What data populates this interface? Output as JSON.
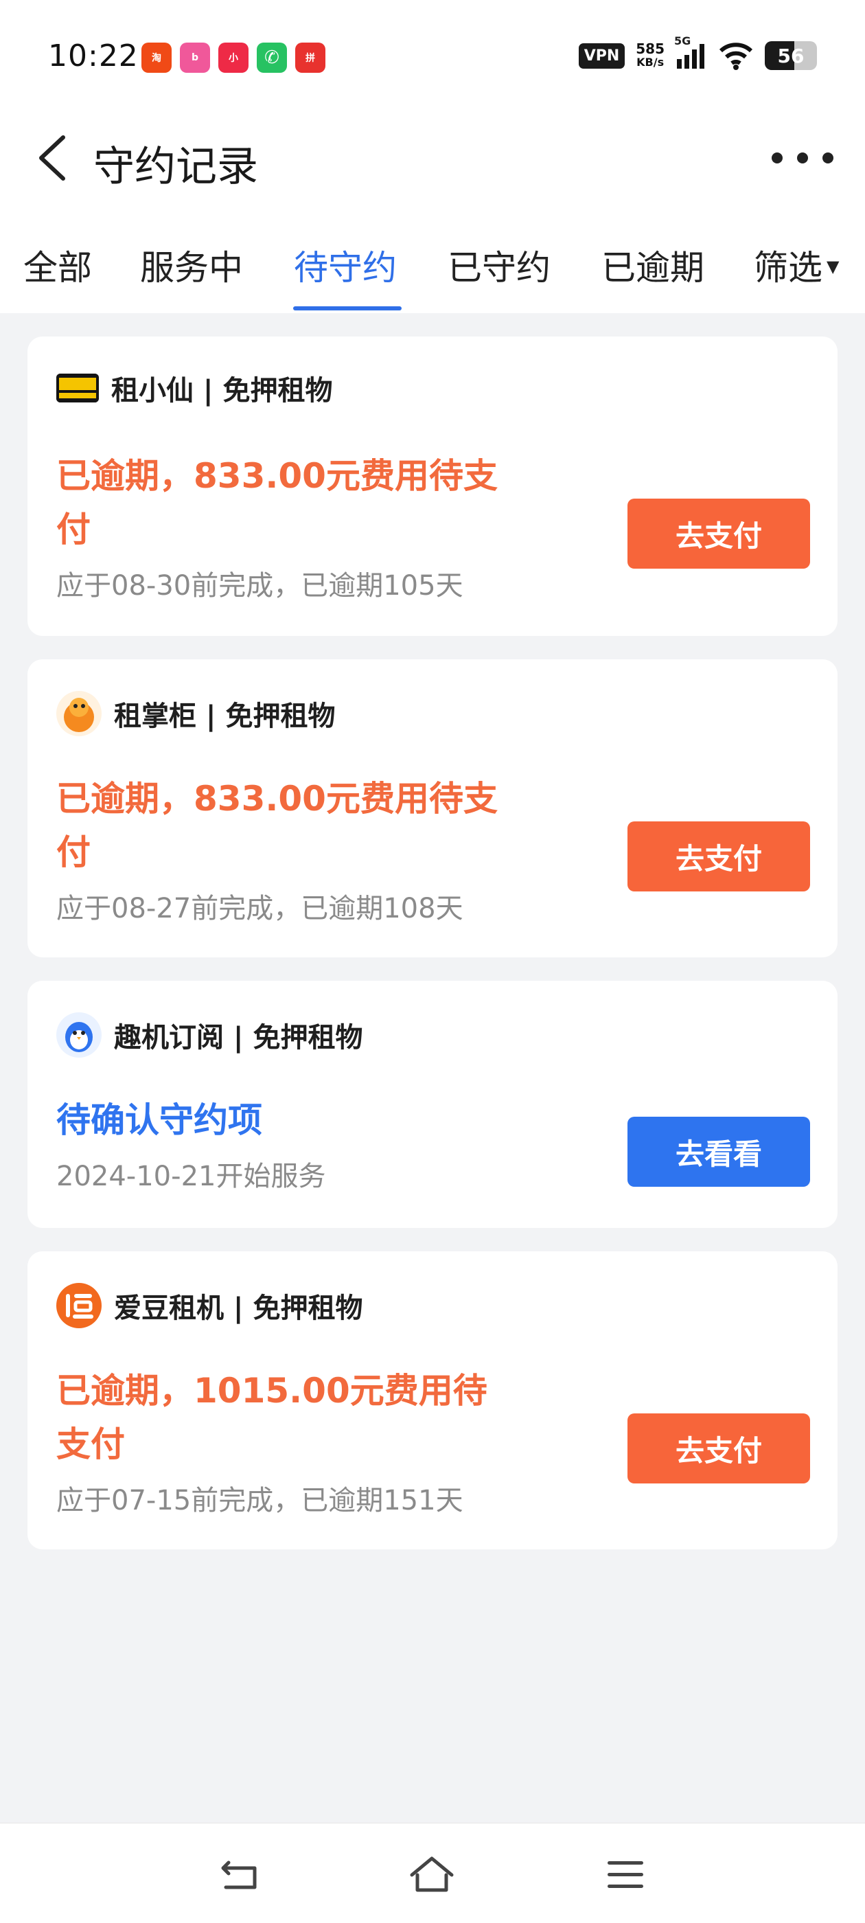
{
  "status_bar": {
    "time": "10:22",
    "apps": [
      {
        "name": "taobao-app-icon",
        "color": "#f04a16",
        "glyph": "淘"
      },
      {
        "name": "bilibili-app-icon",
        "color": "#f0589a",
        "glyph": "b"
      },
      {
        "name": "xiaohongshu-app-icon",
        "color": "#ee2a46",
        "glyph": "小"
      },
      {
        "name": "phone-app-icon",
        "color": "#27c262",
        "glyph": "✆"
      },
      {
        "name": "pinduoduo-app-icon",
        "color": "#e8322e",
        "glyph": "拼"
      }
    ],
    "vpn": "VPN",
    "speed_value": "585",
    "speed_unit": "KB/s",
    "network": "5G",
    "battery": "56",
    "battery_level": 0.56
  },
  "header": {
    "title": "守约记录"
  },
  "tabs": {
    "items": [
      "全部",
      "服务中",
      "待守约",
      "已守约",
      "已逾期",
      "筛选"
    ],
    "active_index": 2
  },
  "cards": [
    {
      "brand": "租小仙 | 免押租物",
      "logo": "zuxiaoxian-logo",
      "status_line1": "已逾期，833.00元费用待支",
      "status_line2": "付",
      "subtext": "应于08-30前完成，已逾期105天",
      "button": "去支付",
      "accent": "#f7653a"
    },
    {
      "brand": "租掌柜 | 免押租物",
      "logo": "zuzhanggui-logo",
      "status_line1": "已逾期，833.00元费用待支",
      "status_line2": "付",
      "subtext": "应于08-27前完成，已逾期108天",
      "button": "去支付",
      "accent": "#f7653a"
    },
    {
      "brand": "趣机订阅 | 免押租物",
      "logo": "quji-logo",
      "status_line1": "待确认守约项",
      "subtext": "2024-10-21开始服务",
      "button": "去看看",
      "accent": "#2e74ef"
    },
    {
      "brand": "爱豆租机 | 免押租物",
      "logo": "aidou-logo",
      "status_line1": "已逾期，1015.00元费用待",
      "status_line2": "支付",
      "subtext": "应于07-15前完成，已逾期151天",
      "button": "去支付",
      "accent": "#f7653a"
    }
  ]
}
